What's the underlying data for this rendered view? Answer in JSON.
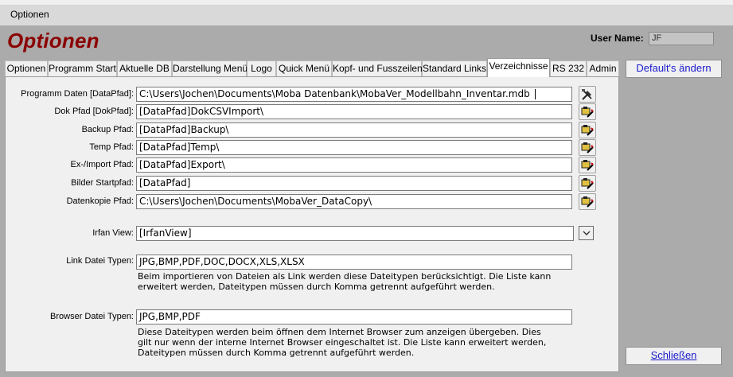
{
  "window": {
    "title": "Optionen"
  },
  "form": {
    "heading": "Optionen",
    "user_label": "User Name:",
    "user_value": "JF"
  },
  "tabs": [
    {
      "label": "Optionen",
      "active": false
    },
    {
      "label": "Programm Start",
      "active": false
    },
    {
      "label": "Aktuelle DB",
      "active": false
    },
    {
      "label": "Darstellung Menü",
      "active": false
    },
    {
      "label": "Logo",
      "active": false
    },
    {
      "label": "Quick Menü",
      "active": false
    },
    {
      "label": "Kopf- und Fusszeilen",
      "active": false
    },
    {
      "label": "Standard Links",
      "active": false
    },
    {
      "label": "Verzeichnisse",
      "active": true
    },
    {
      "label": "RS 232",
      "active": false
    },
    {
      "label": "Admin",
      "active": false
    }
  ],
  "paths": [
    {
      "label": "Programm Daten [DataPfad]:",
      "value": "C:\\Users\\Jochen\\Documents\\Moba Datenbank\\MobaVer_Modellbahn_Inventar.mdb",
      "icon": "tools-icon"
    },
    {
      "label": "Dok Pfad [DokPfad]:",
      "value": "[DataPfad]DokCSVImport\\",
      "icon": "folder-edit-icon"
    },
    {
      "label": "Backup Pfad:",
      "value": "[DataPfad]Backup\\",
      "icon": "folder-edit-icon"
    },
    {
      "label": "Temp Pfad:",
      "value": "[DataPfad]Temp\\",
      "icon": "folder-edit-icon"
    },
    {
      "label": "Ex-/Import Pfad:",
      "value": "[DataPfad]Export\\",
      "icon": "folder-edit-icon"
    },
    {
      "label": "Bilder Startpfad:",
      "value": "[DataPfad]",
      "icon": "folder-edit-icon"
    },
    {
      "label": "Datenkopie Pfad:",
      "value": "C:\\Users\\Jochen\\Documents\\MobaVer_DataCopy\\",
      "icon": "folder-edit-icon"
    }
  ],
  "irfan": {
    "label": "Irfan View:",
    "value": "[IrfanView]"
  },
  "link_types": {
    "label": "Link Datei Typen:",
    "value": "JPG,BMP,PDF,DOC,DOCX,XLS,XLSX",
    "help_lines": [
      "Beim importieren von Dateien als Link werden diese Dateitypen berücksichtigt. Die Liste kann",
      "erweitert werden, Dateitypen müssen durch Komma getrennt aufgeführt werden."
    ]
  },
  "browser_types": {
    "label": "Browser Datei Typen:",
    "value": "JPG,BMP,PDF",
    "help_lines": [
      "Diese Dateitypen werden beim öffnen dem Internet Browser zum anzeigen übergeben. Dies",
      "gilt nur wenn der interne Internet Browser eingeschaltet ist. Die Liste kann erweitert werden,",
      "Dateitypen müssen durch Komma getrennt aufgeführt werden."
    ]
  },
  "buttons": {
    "defaults": "Default's ändern",
    "close": "Schließen"
  },
  "colors": {
    "heading": "#8b0000",
    "side_button_text": "#1a1acc",
    "form_background": "#ababab",
    "tab_panel": "#f0f0f0"
  }
}
